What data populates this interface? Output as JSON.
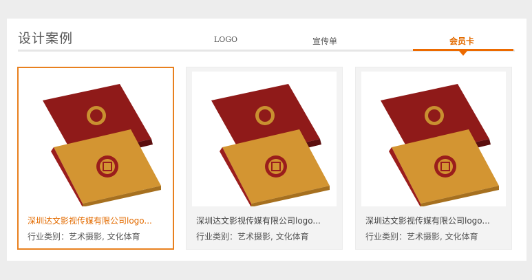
{
  "section": {
    "title": "设计案例"
  },
  "tabs": [
    {
      "label": "LOGO"
    },
    {
      "label": "宣传单"
    },
    {
      "label": "会员卡",
      "active": true
    }
  ],
  "cases": [
    {
      "name": "深圳达文影视传媒有限公司logo...",
      "category": "行业类别：艺术摄影, 文化体育",
      "highlighted": true
    },
    {
      "name": "深圳达文影视传媒有限公司logo...",
      "category": "行业类别：艺术摄影, 文化体育"
    },
    {
      "name": "深圳达文影视传媒有限公司logo...",
      "category": "行业类别：艺术摄影, 文化体育"
    }
  ],
  "colors": {
    "accent": "#ec6a00",
    "book_red": "#9a1d1c",
    "book_gold": "#d79a35"
  }
}
